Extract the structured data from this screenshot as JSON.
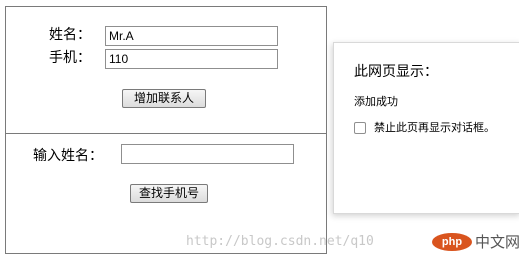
{
  "form": {
    "name_label": "姓名：",
    "name_value": "Mr.A",
    "phone_label": "手机：",
    "phone_value": "110",
    "add_button": "增加联系人",
    "search_label": "输入姓名：",
    "search_value": "",
    "search_button": "查找手机号"
  },
  "dialog": {
    "title": "此网页显示：",
    "message": "添加成功",
    "checkbox_label": "禁止此页再显示对话框。",
    "checkbox_checked": false
  },
  "watermark": {
    "text": "http://blog.csdn.net/q10",
    "brand_badge": "php",
    "brand_text": "中文网"
  }
}
